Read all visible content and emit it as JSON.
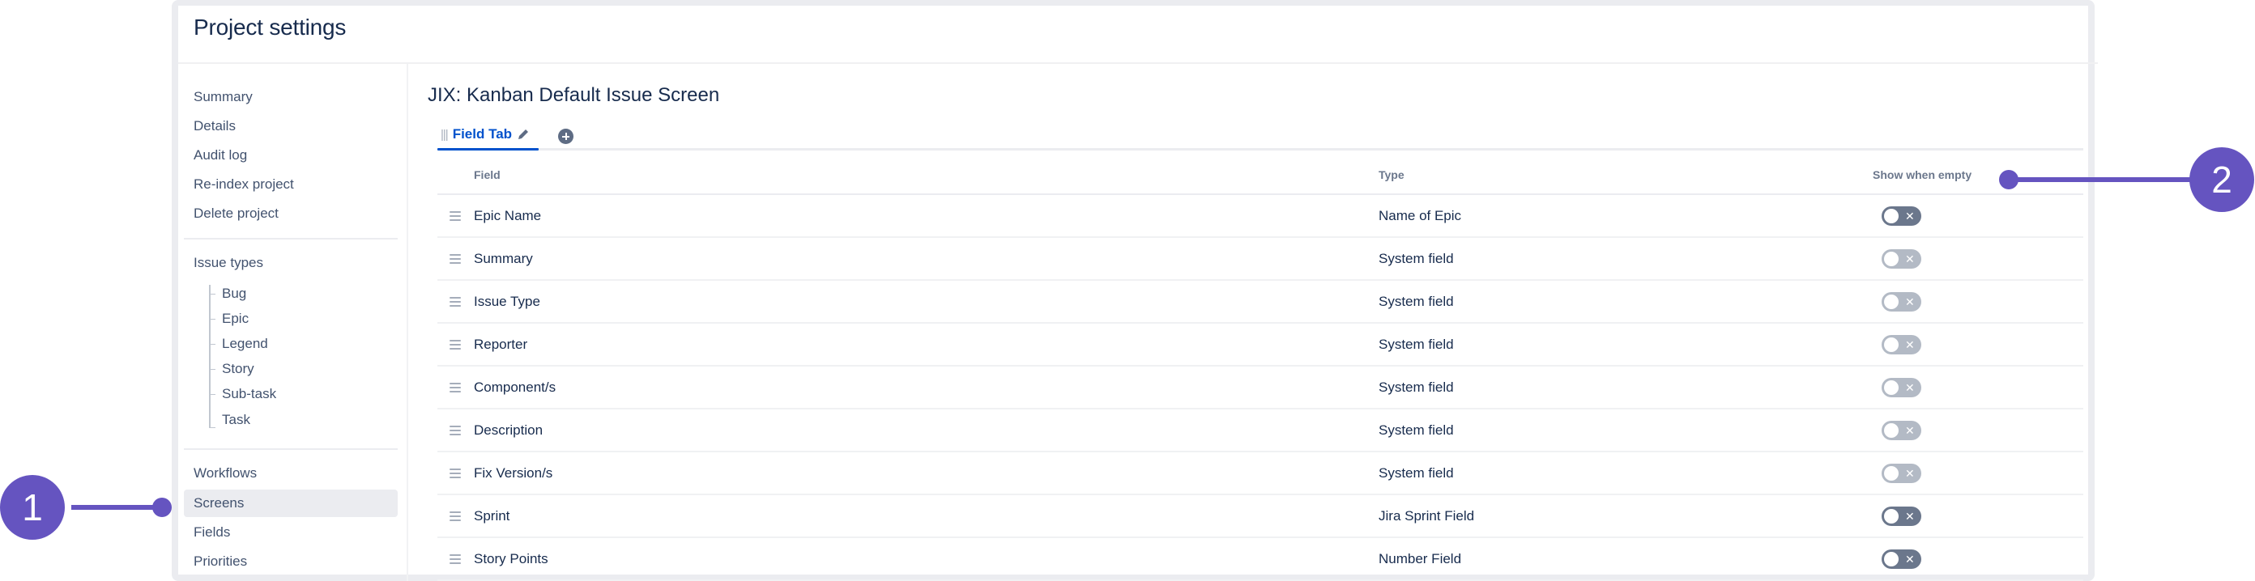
{
  "header": {
    "title": "Project settings"
  },
  "sidebar": {
    "top_items": [
      {
        "label": "Summary"
      },
      {
        "label": "Details"
      },
      {
        "label": "Audit log"
      },
      {
        "label": "Re-index project"
      },
      {
        "label": "Delete project"
      }
    ],
    "issue_types": {
      "heading": "Issue types",
      "items": [
        {
          "label": "Bug"
        },
        {
          "label": "Epic"
        },
        {
          "label": "Legend"
        },
        {
          "label": "Story"
        },
        {
          "label": "Sub-task"
        },
        {
          "label": "Task"
        }
      ]
    },
    "bottom_items": [
      {
        "label": "Workflows",
        "active": false
      },
      {
        "label": "Screens",
        "active": true
      },
      {
        "label": "Fields",
        "active": false
      },
      {
        "label": "Priorities",
        "active": false
      }
    ]
  },
  "main": {
    "title": "JIX: Kanban Default Issue Screen",
    "tabs": [
      {
        "label": "Field Tab",
        "active": true
      }
    ],
    "add_tab_icon": "plus-circle-icon",
    "table": {
      "columns": {
        "field": "Field",
        "type": "Type",
        "show_when_empty": "Show when empty"
      },
      "rows": [
        {
          "field": "Epic Name",
          "type": "Name of Epic",
          "show_when_empty": false,
          "toggle_enabled": true
        },
        {
          "field": "Summary",
          "type": "System field",
          "show_when_empty": false,
          "toggle_enabled": false
        },
        {
          "field": "Issue Type",
          "type": "System field",
          "show_when_empty": false,
          "toggle_enabled": false
        },
        {
          "field": "Reporter",
          "type": "System field",
          "show_when_empty": false,
          "toggle_enabled": false
        },
        {
          "field": "Component/s",
          "type": "System field",
          "show_when_empty": false,
          "toggle_enabled": false
        },
        {
          "field": "Description",
          "type": "System field",
          "show_when_empty": false,
          "toggle_enabled": false
        },
        {
          "field": "Fix Version/s",
          "type": "System field",
          "show_when_empty": false,
          "toggle_enabled": false
        },
        {
          "field": "Sprint",
          "type": "Jira Sprint Field",
          "show_when_empty": false,
          "toggle_enabled": true
        },
        {
          "field": "Story Points",
          "type": "Number Field",
          "show_when_empty": false,
          "toggle_enabled": true
        }
      ],
      "toggle_off_glyph": "✕"
    }
  },
  "callouts": [
    {
      "number": "1",
      "target": "Screens"
    },
    {
      "number": "2",
      "target": "Show when empty"
    }
  ],
  "colors": {
    "accent": "#0052cc",
    "callout": "#6554c0",
    "toggle_enabled": "#6b778c",
    "toggle_disabled": "#b3bac5",
    "text": "#172b4d",
    "sidebar_text": "#42526e"
  }
}
